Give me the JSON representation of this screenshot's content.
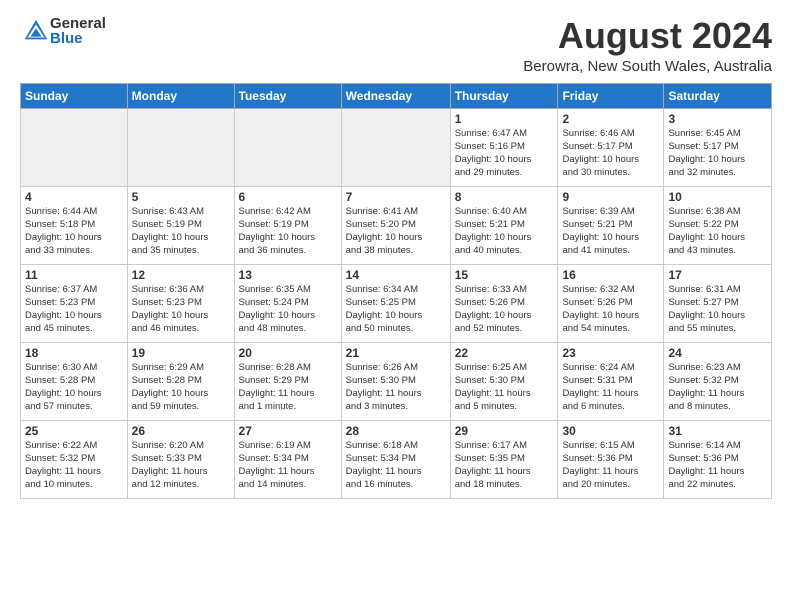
{
  "logo": {
    "general": "General",
    "blue": "Blue"
  },
  "title": {
    "month_year": "August 2024",
    "location": "Berowra, New South Wales, Australia"
  },
  "days_of_week": [
    "Sunday",
    "Monday",
    "Tuesday",
    "Wednesday",
    "Thursday",
    "Friday",
    "Saturday"
  ],
  "weeks": [
    [
      {
        "day": "",
        "info": "",
        "empty": true
      },
      {
        "day": "",
        "info": "",
        "empty": true
      },
      {
        "day": "",
        "info": "",
        "empty": true
      },
      {
        "day": "",
        "info": "",
        "empty": true
      },
      {
        "day": "1",
        "info": "Sunrise: 6:47 AM\nSunset: 5:16 PM\nDaylight: 10 hours\nand 29 minutes."
      },
      {
        "day": "2",
        "info": "Sunrise: 6:46 AM\nSunset: 5:17 PM\nDaylight: 10 hours\nand 30 minutes."
      },
      {
        "day": "3",
        "info": "Sunrise: 6:45 AM\nSunset: 5:17 PM\nDaylight: 10 hours\nand 32 minutes."
      }
    ],
    [
      {
        "day": "4",
        "info": "Sunrise: 6:44 AM\nSunset: 5:18 PM\nDaylight: 10 hours\nand 33 minutes."
      },
      {
        "day": "5",
        "info": "Sunrise: 6:43 AM\nSunset: 5:19 PM\nDaylight: 10 hours\nand 35 minutes."
      },
      {
        "day": "6",
        "info": "Sunrise: 6:42 AM\nSunset: 5:19 PM\nDaylight: 10 hours\nand 36 minutes."
      },
      {
        "day": "7",
        "info": "Sunrise: 6:41 AM\nSunset: 5:20 PM\nDaylight: 10 hours\nand 38 minutes."
      },
      {
        "day": "8",
        "info": "Sunrise: 6:40 AM\nSunset: 5:21 PM\nDaylight: 10 hours\nand 40 minutes."
      },
      {
        "day": "9",
        "info": "Sunrise: 6:39 AM\nSunset: 5:21 PM\nDaylight: 10 hours\nand 41 minutes."
      },
      {
        "day": "10",
        "info": "Sunrise: 6:38 AM\nSunset: 5:22 PM\nDaylight: 10 hours\nand 43 minutes."
      }
    ],
    [
      {
        "day": "11",
        "info": "Sunrise: 6:37 AM\nSunset: 5:23 PM\nDaylight: 10 hours\nand 45 minutes."
      },
      {
        "day": "12",
        "info": "Sunrise: 6:36 AM\nSunset: 5:23 PM\nDaylight: 10 hours\nand 46 minutes."
      },
      {
        "day": "13",
        "info": "Sunrise: 6:35 AM\nSunset: 5:24 PM\nDaylight: 10 hours\nand 48 minutes."
      },
      {
        "day": "14",
        "info": "Sunrise: 6:34 AM\nSunset: 5:25 PM\nDaylight: 10 hours\nand 50 minutes."
      },
      {
        "day": "15",
        "info": "Sunrise: 6:33 AM\nSunset: 5:26 PM\nDaylight: 10 hours\nand 52 minutes."
      },
      {
        "day": "16",
        "info": "Sunrise: 6:32 AM\nSunset: 5:26 PM\nDaylight: 10 hours\nand 54 minutes."
      },
      {
        "day": "17",
        "info": "Sunrise: 6:31 AM\nSunset: 5:27 PM\nDaylight: 10 hours\nand 55 minutes."
      }
    ],
    [
      {
        "day": "18",
        "info": "Sunrise: 6:30 AM\nSunset: 5:28 PM\nDaylight: 10 hours\nand 57 minutes."
      },
      {
        "day": "19",
        "info": "Sunrise: 6:29 AM\nSunset: 5:28 PM\nDaylight: 10 hours\nand 59 minutes."
      },
      {
        "day": "20",
        "info": "Sunrise: 6:28 AM\nSunset: 5:29 PM\nDaylight: 11 hours\nand 1 minute."
      },
      {
        "day": "21",
        "info": "Sunrise: 6:26 AM\nSunset: 5:30 PM\nDaylight: 11 hours\nand 3 minutes."
      },
      {
        "day": "22",
        "info": "Sunrise: 6:25 AM\nSunset: 5:30 PM\nDaylight: 11 hours\nand 5 minutes."
      },
      {
        "day": "23",
        "info": "Sunrise: 6:24 AM\nSunset: 5:31 PM\nDaylight: 11 hours\nand 6 minutes."
      },
      {
        "day": "24",
        "info": "Sunrise: 6:23 AM\nSunset: 5:32 PM\nDaylight: 11 hours\nand 8 minutes."
      }
    ],
    [
      {
        "day": "25",
        "info": "Sunrise: 6:22 AM\nSunset: 5:32 PM\nDaylight: 11 hours\nand 10 minutes."
      },
      {
        "day": "26",
        "info": "Sunrise: 6:20 AM\nSunset: 5:33 PM\nDaylight: 11 hours\nand 12 minutes."
      },
      {
        "day": "27",
        "info": "Sunrise: 6:19 AM\nSunset: 5:34 PM\nDaylight: 11 hours\nand 14 minutes."
      },
      {
        "day": "28",
        "info": "Sunrise: 6:18 AM\nSunset: 5:34 PM\nDaylight: 11 hours\nand 16 minutes."
      },
      {
        "day": "29",
        "info": "Sunrise: 6:17 AM\nSunset: 5:35 PM\nDaylight: 11 hours\nand 18 minutes."
      },
      {
        "day": "30",
        "info": "Sunrise: 6:15 AM\nSunset: 5:36 PM\nDaylight: 11 hours\nand 20 minutes."
      },
      {
        "day": "31",
        "info": "Sunrise: 6:14 AM\nSunset: 5:36 PM\nDaylight: 11 hours\nand 22 minutes."
      }
    ]
  ]
}
